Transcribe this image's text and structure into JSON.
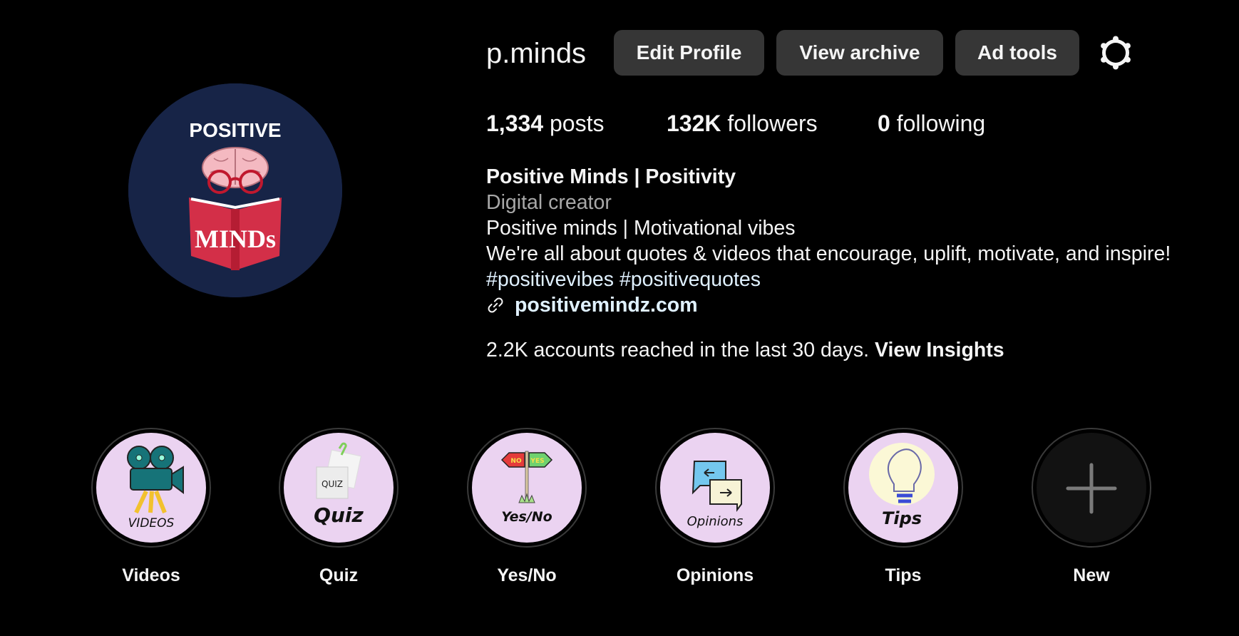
{
  "profile": {
    "username": "p.minds",
    "avatar": {
      "top_text": "POSITIVE",
      "book_text": "MINDs",
      "background": "#172447"
    }
  },
  "actions": {
    "edit_profile": "Edit Profile",
    "view_archive": "View archive",
    "ad_tools": "Ad tools",
    "settings_icon": "gear-icon"
  },
  "stats": {
    "posts": {
      "count": "1,334",
      "label": "posts"
    },
    "followers": {
      "count": "132K",
      "label": "followers"
    },
    "following": {
      "count": "0",
      "label": "following"
    }
  },
  "bio": {
    "name": "Positive Minds | Positivity",
    "category": "Digital creator",
    "line1": "Positive minds | Motivational vibes",
    "line2": "We're all about quotes & videos that encourage, uplift, motivate, and inspire!",
    "hashtags": [
      "#positivevibes",
      "#positivequotes"
    ],
    "link": "positivemindz.com",
    "link_icon": "link-icon",
    "link_color": "#e0f1ff"
  },
  "insights": {
    "text": "2.2K accounts reached in the last 30 days.",
    "link_label": "View Insights"
  },
  "highlights": [
    {
      "label": "Videos",
      "cover_text": "VIDEOS"
    },
    {
      "label": "Quiz",
      "cover_text": "Quiz",
      "sub_text": "QUIZ"
    },
    {
      "label": "Yes/No",
      "cover_text": "Yes/No",
      "sign_left": "NO",
      "sign_right": "YES"
    },
    {
      "label": "Opinions",
      "cover_text": "Opinions"
    },
    {
      "label": "Tips",
      "cover_text": "Tips"
    },
    {
      "label": "New"
    }
  ],
  "colors": {
    "background": "#000000",
    "button": "#363636",
    "text": "#f5f5f5",
    "secondary_text": "#a8a8a8",
    "highlight_cover": "#ebd3f1"
  }
}
